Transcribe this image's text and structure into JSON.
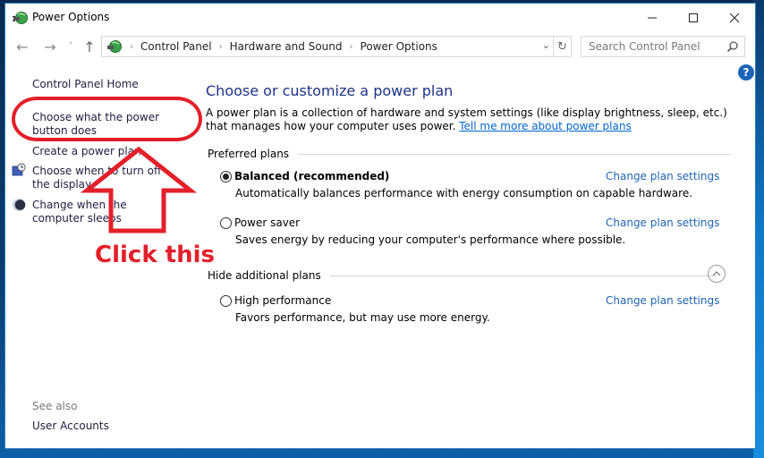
{
  "window": {
    "title": "Power Options",
    "controls": {
      "minimize": "—",
      "maximize": "☐",
      "close": "✕"
    }
  },
  "navigation": {
    "back_icon": "←",
    "forward_icon": "→",
    "recent_icon": "˅",
    "up_icon": "↑",
    "breadcrumbs": [
      "Control Panel",
      "Hardware and Sound",
      "Power Options"
    ],
    "separator": "›",
    "dropdown_icon": "⌄",
    "refresh_icon": "↻",
    "search_placeholder": "Search Control Panel"
  },
  "help": {
    "label": "?"
  },
  "left_pane": {
    "home": "Control Panel Home",
    "links": [
      "Choose what the power button does",
      "Create a power plan",
      "Choose when to turn off the display",
      "Change when the computer sleeps"
    ],
    "see_also_label": "See also",
    "see_also_links": [
      "User Accounts"
    ]
  },
  "main": {
    "title": "Choose or customize a power plan",
    "intro_text": "A power plan is a collection of hardware and system settings (like display brightness, sleep, etc.) that manages how your computer uses power. ",
    "intro_link": "Tell me more about power plans",
    "preferred_header": "Preferred plans",
    "additional_header": "Hide additional plans",
    "change_link": "Change plan settings",
    "plans": [
      {
        "name": "Balanced (recommended)",
        "description": "Automatically balances performance with energy consumption on capable hardware.",
        "selected": true
      },
      {
        "name": "Power saver",
        "description": "Saves energy by reducing your computer's performance where possible.",
        "selected": false
      },
      {
        "name": "High performance",
        "description": "Favors performance, but may use more energy.",
        "selected": false
      }
    ]
  },
  "annotation": {
    "text": "Click this",
    "color": "#e3202a"
  }
}
